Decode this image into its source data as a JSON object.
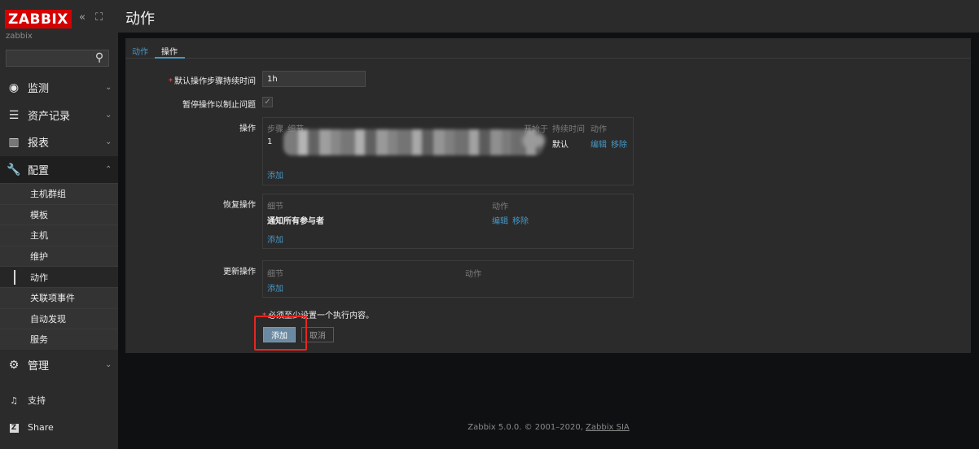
{
  "sidebar": {
    "logo": "ZABBIX",
    "collapse_icon": "«",
    "kiosk_icon": "⛶",
    "server_name": "zabbix",
    "menu": [
      {
        "label": "监测",
        "icon": "eye-icon"
      },
      {
        "label": "资产记录",
        "icon": "list-icon"
      },
      {
        "label": "报表",
        "icon": "bar-chart-icon"
      },
      {
        "label": "配置",
        "icon": "wrench-icon"
      },
      {
        "label": "管理",
        "icon": "gear-icon"
      }
    ],
    "submenu": [
      "主机群组",
      "模板",
      "主机",
      "维护",
      "动作",
      "关联项事件",
      "自动发现",
      "服务"
    ],
    "support": "支持",
    "share": "Share",
    "share_icon": "Z"
  },
  "header": {
    "title": "动作"
  },
  "tabs": {
    "action": "动作",
    "operations": "操作"
  },
  "form": {
    "default_duration_label": "默认操作步骤持续时间",
    "default_duration_value": "1h",
    "pause_label": "暂停操作以制止问题",
    "operations": {
      "label": "操作",
      "col_steps": "步骤",
      "col_details": "细节",
      "col_start": "开始于",
      "col_duration": "持续时间",
      "col_action": "动作",
      "row_step": "1",
      "row_duration": "默认",
      "edit": "编辑",
      "remove": "移除",
      "add": "添加"
    },
    "recovery": {
      "label": "恢复操作",
      "col_details": "细节",
      "col_action": "动作",
      "row_details": "通知所有参与者",
      "edit": "编辑",
      "remove": "移除",
      "add": "添加"
    },
    "update": {
      "label": "更新操作",
      "col_details": "细节",
      "col_action": "动作",
      "add": "添加"
    },
    "required_note": "必须至少设置一个执行内容。",
    "add_button": "添加",
    "cancel_button": "取消"
  },
  "footer": {
    "text": "Zabbix 5.0.0. © 2001–2020, ",
    "company": "Zabbix SIA"
  },
  "colors": {
    "brand": "#d40000",
    "link": "#4796c4",
    "highlight": "#e8251f"
  }
}
